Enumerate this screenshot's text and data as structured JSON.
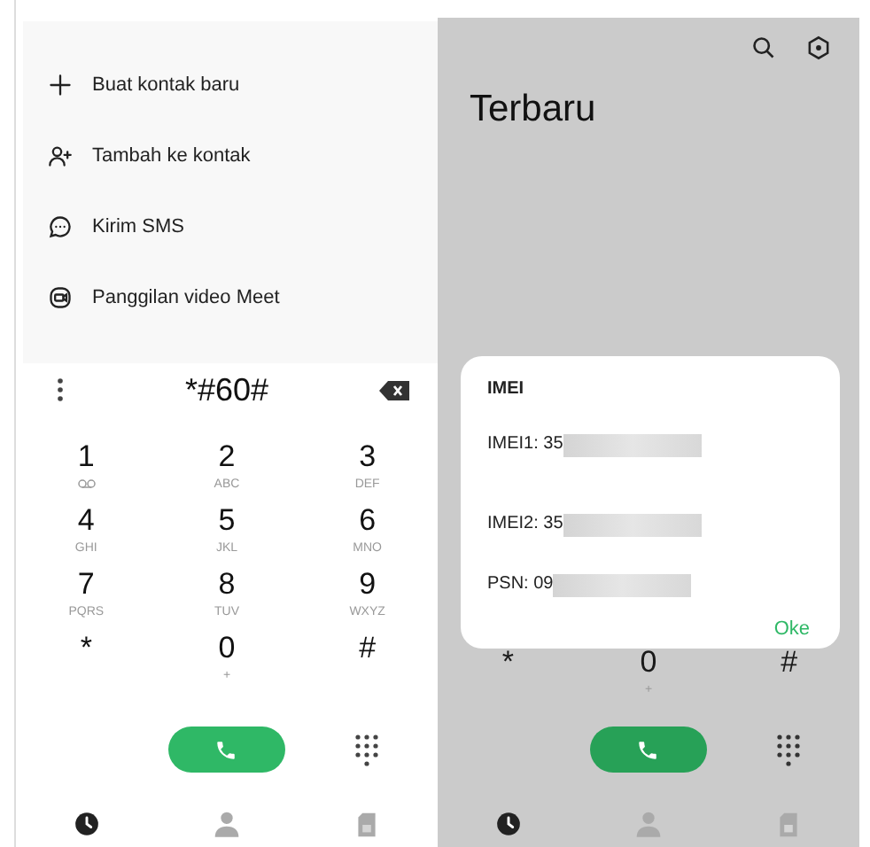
{
  "left_screen": {
    "menu": [
      {
        "label": "Buat kontak baru"
      },
      {
        "label": "Tambah ke kontak"
      },
      {
        "label": "Kirim SMS"
      },
      {
        "label": "Panggilan video Meet"
      }
    ],
    "dial_input": "*#60#",
    "keys": [
      {
        "digit": "1"
      },
      {
        "digit": "2",
        "letters": "ABC"
      },
      {
        "digit": "3",
        "letters": "DEF"
      },
      {
        "digit": "4",
        "letters": "GHI"
      },
      {
        "digit": "5",
        "letters": "JKL"
      },
      {
        "digit": "6",
        "letters": "MNO"
      },
      {
        "digit": "7",
        "letters": "PQRS"
      },
      {
        "digit": "8",
        "letters": "TUV"
      },
      {
        "digit": "9",
        "letters": "WXYZ"
      },
      {
        "digit": "*"
      },
      {
        "digit": "0",
        "letters": "+"
      },
      {
        "digit": "#"
      }
    ],
    "nav": [
      {
        "selected": true
      },
      {
        "selected": false
      },
      {
        "selected": false
      }
    ]
  },
  "right_screen": {
    "title": "Terbaru",
    "keys": [
      {
        "digit": "*"
      },
      {
        "digit": "0",
        "letters": "+"
      },
      {
        "digit": "#"
      }
    ],
    "nav": [
      {
        "selected": true
      },
      {
        "selected": false
      },
      {
        "selected": false
      }
    ],
    "dialog": {
      "title": "IMEI",
      "rows": [
        {
          "label": "IMEI1: 35"
        },
        {
          "label": "IMEI2: 35"
        },
        {
          "label": "PSN: 09"
        }
      ],
      "button": "Oke"
    }
  }
}
